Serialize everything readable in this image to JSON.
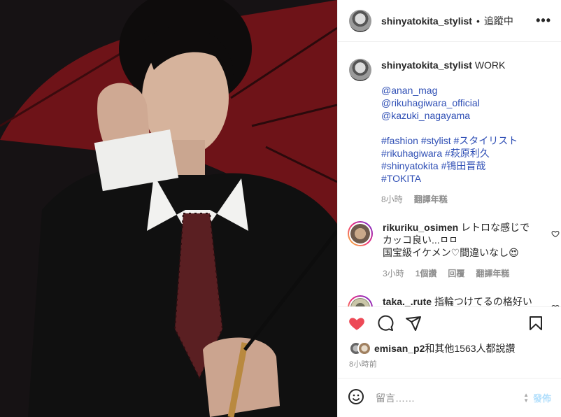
{
  "header": {
    "username": "shinyatokita_stylist",
    "dot": "•",
    "follow_status": "追蹤中",
    "more": "•••"
  },
  "caption": {
    "username": "shinyatokita_stylist",
    "text": "WORK",
    "mentions": [
      "@anan_mag",
      "@rikuhagiwara_official",
      "@kazuki_nagayama"
    ],
    "hashtags": [
      "#fashion #stylist #スタイリスト",
      "#rikuhagiwara #萩原利久",
      "#shinyatokita #鴇田晋哉",
      "#TOKITA"
    ],
    "time": "8小時",
    "translate": "翻譯年糕"
  },
  "comments": [
    {
      "username": "rikuriku_osimen",
      "lines": [
        "レトロな感じでカッコ良い...ㅁㅁ",
        "国宝級イケメン♡間違いなし😍"
      ],
      "time": "3小時",
      "likes": "1個讚",
      "reply": "回覆",
      "translate": "翻譯年糕"
    },
    {
      "username": "taka._.rute",
      "lines": [
        "指輪つけてるの格好いい言うね"
      ]
    }
  ],
  "likes": {
    "user": "emisan_p2",
    "rest": "和其他1563人都說讚"
  },
  "post_time": "8小時前",
  "add_comment": {
    "placeholder": "留言……",
    "post_label": "發佈"
  },
  "colors": {
    "link": "#2f4fb5",
    "heart": "#ed4956",
    "post_disabled": "#b2dffc"
  }
}
